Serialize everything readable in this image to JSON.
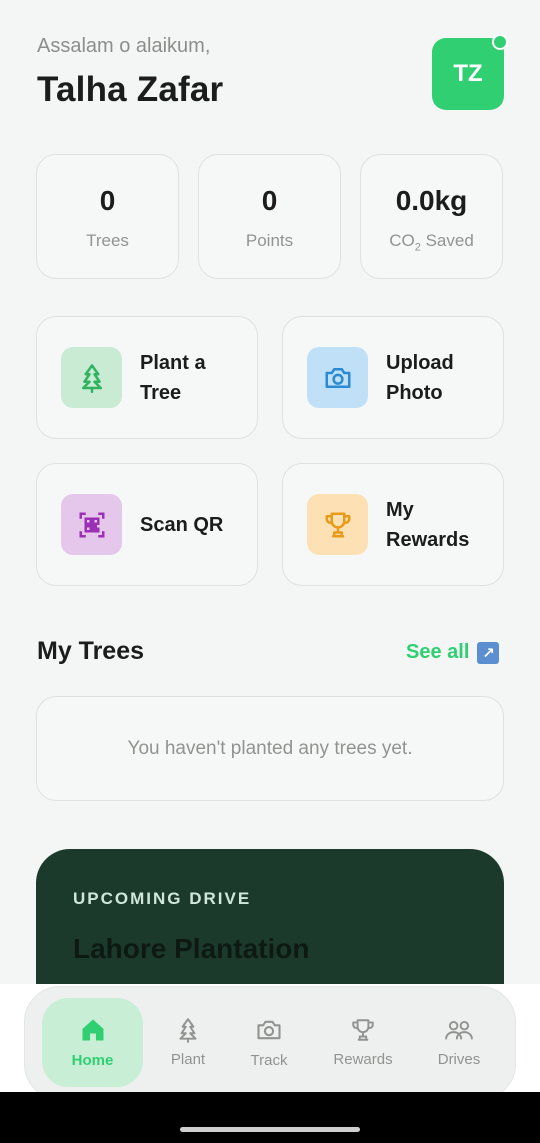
{
  "header": {
    "greeting": "Assalam o alaikum,",
    "user_name": "Talha Zafar",
    "avatar_initials": "TZ"
  },
  "stats": [
    {
      "value": "0",
      "label": "Trees"
    },
    {
      "value": "0",
      "label": "Points"
    },
    {
      "value": "0.0kg",
      "label_prefix": "CO",
      "label_sub": "2",
      "label_suffix": " Saved"
    }
  ],
  "actions": [
    {
      "label": "Plant a\nTree",
      "icon": "tree-icon",
      "icon_bg": "#c9ebd3",
      "icon_color": "#2fb360"
    },
    {
      "label": "Upload\nPhoto",
      "icon": "camera-icon",
      "icon_bg": "#bfe0f7",
      "icon_color": "#2a8ad4"
    },
    {
      "label": "Scan QR",
      "icon": "qr-code-icon",
      "icon_bg": "#e5c7ec",
      "icon_color": "#9b2fb5"
    },
    {
      "label": "My\nRewards",
      "icon": "trophy-icon",
      "icon_bg": "#fde0b4",
      "icon_color": "#e79b18"
    }
  ],
  "my_trees": {
    "title": "My Trees",
    "see_all": "See all",
    "empty_text": "You haven't planted any trees yet."
  },
  "drive": {
    "tag": "UPCOMING DRIVE",
    "title": "Lahore Plantation"
  },
  "nav": {
    "items": [
      {
        "label": "Home",
        "icon": "home-icon",
        "active": true
      },
      {
        "label": "Plant",
        "icon": "tree-icon",
        "active": false
      },
      {
        "label": "Track",
        "icon": "camera-icon",
        "active": false
      },
      {
        "label": "Rewards",
        "icon": "trophy-icon",
        "active": false
      },
      {
        "label": "Drives",
        "icon": "people-icon",
        "active": false
      }
    ]
  },
  "colors": {
    "accent": "#2fcf72",
    "drive_bg": "#1c3a2c",
    "background": "#f4f6f5"
  }
}
